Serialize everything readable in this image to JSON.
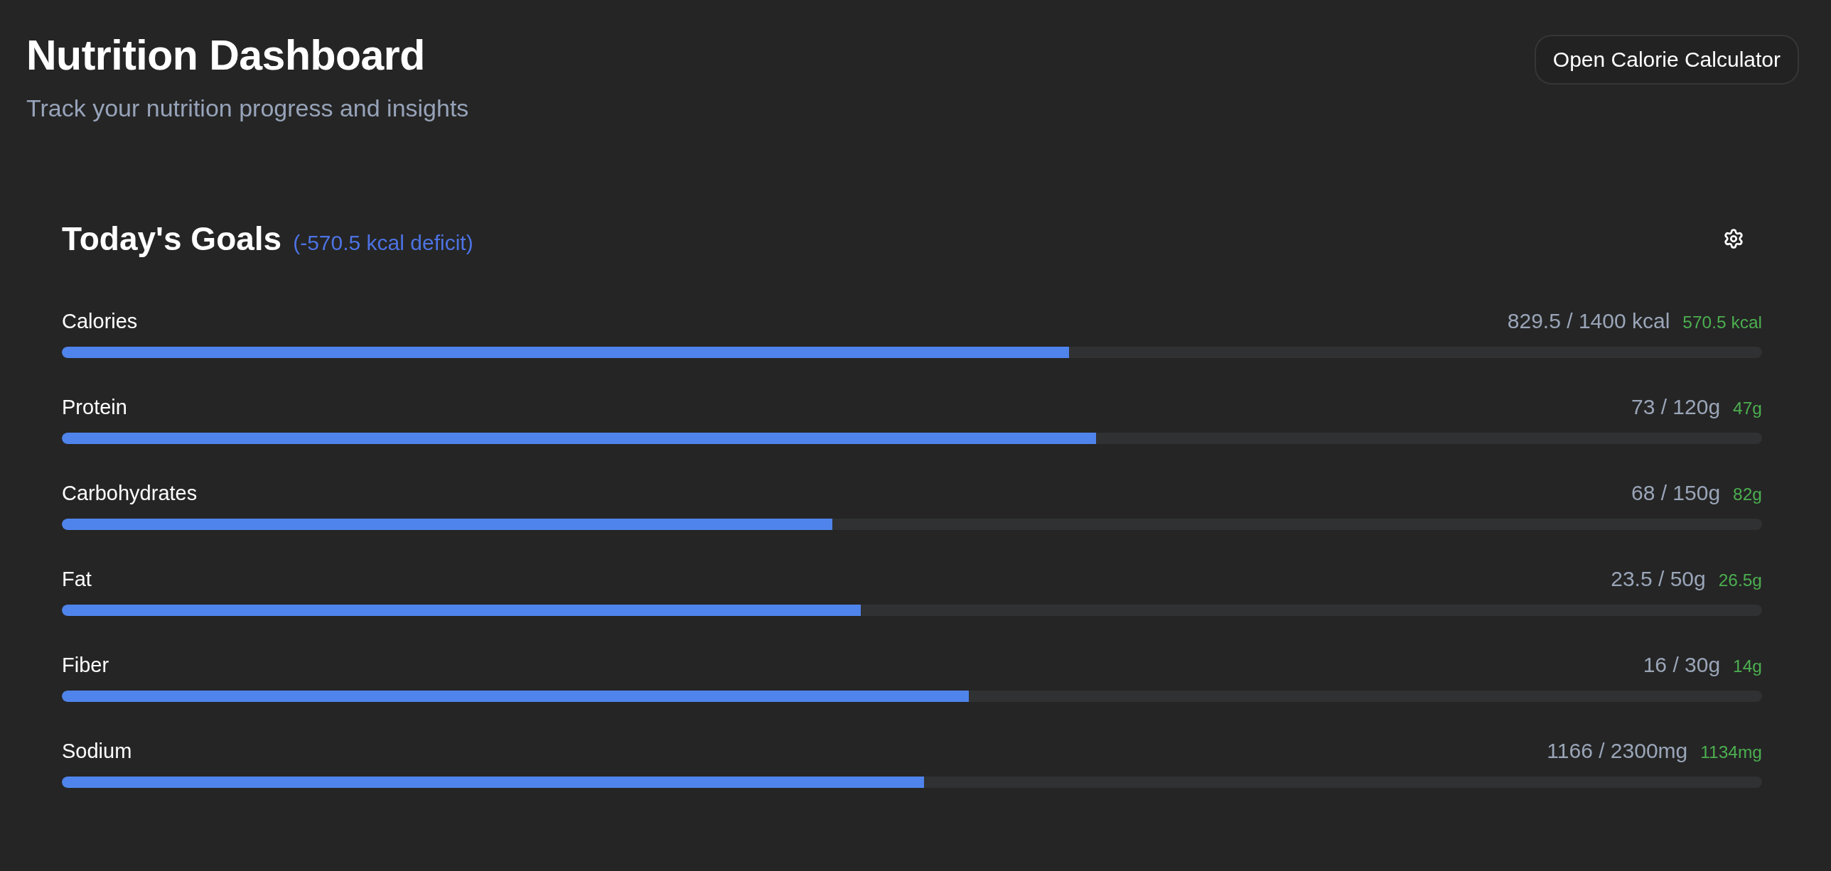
{
  "header": {
    "title": "Nutrition Dashboard",
    "subtitle": "Track your nutrition progress and insights",
    "button": "Open Calorie Calculator"
  },
  "goals": {
    "title": "Today's Goals",
    "deficit": "(-570.5 kcal deficit)",
    "nutrients": [
      {
        "name": "Calories",
        "reading": "829.5 / 1400 kcal",
        "remaining": "570.5 kcal",
        "level": 0.5925
      },
      {
        "name": "Protein",
        "reading": "73 / 120g",
        "remaining": "47g",
        "level": 0.6083
      },
      {
        "name": "Carbohydrates",
        "reading": "68 / 150g",
        "remaining": "82g",
        "level": 0.4533
      },
      {
        "name": "Fat",
        "reading": "23.5 / 50g",
        "remaining": "26.5g",
        "level": 0.47
      },
      {
        "name": "Fiber",
        "reading": "16 / 30g",
        "remaining": "14g",
        "level": 0.5333
      },
      {
        "name": "Sodium",
        "reading": "1166 / 2300mg",
        "remaining": "1134mg",
        "level": 0.507
      }
    ]
  }
}
